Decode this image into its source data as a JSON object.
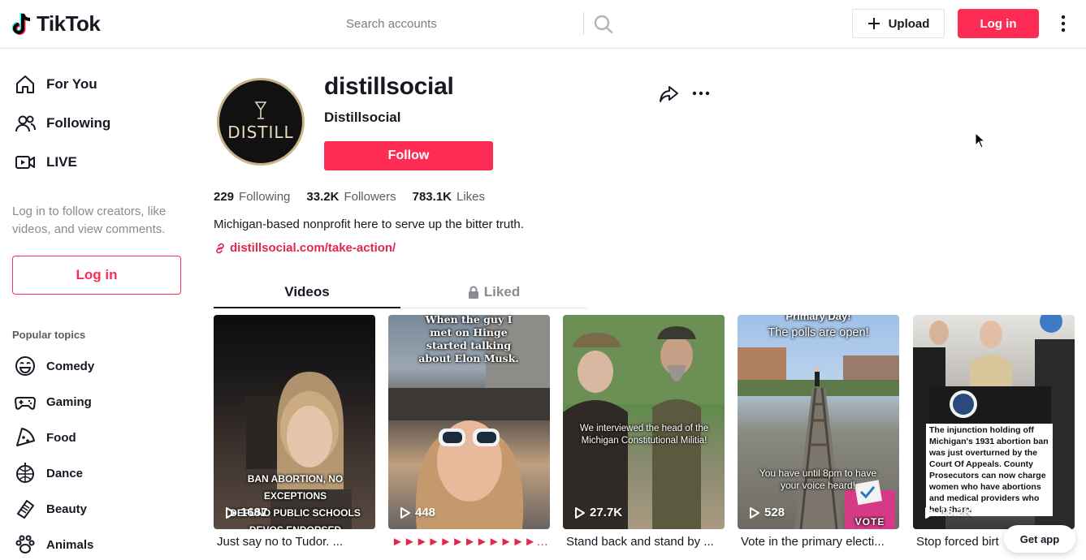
{
  "header": {
    "logo_text": "TikTok",
    "search_placeholder": "Search accounts",
    "upload_label": "Upload",
    "login_label": "Log in"
  },
  "sidebar": {
    "nav": [
      {
        "label": "For You",
        "icon": "home-icon"
      },
      {
        "label": "Following",
        "icon": "people-icon"
      },
      {
        "label": "LIVE",
        "icon": "live-icon"
      }
    ],
    "login_hint": "Log in to follow creators, like videos, and view comments.",
    "login_label": "Log in",
    "popular_title": "Popular topics",
    "topics": [
      {
        "label": "Comedy",
        "icon": "comedy-icon"
      },
      {
        "label": "Gaming",
        "icon": "gaming-icon"
      },
      {
        "label": "Food",
        "icon": "food-icon"
      },
      {
        "label": "Dance",
        "icon": "dance-icon"
      },
      {
        "label": "Beauty",
        "icon": "beauty-icon"
      },
      {
        "label": "Animals",
        "icon": "animals-icon"
      }
    ]
  },
  "profile": {
    "avatar_text": "DISTILL",
    "username": "distillsocial",
    "nickname": "Distillsocial",
    "follow_label": "Follow",
    "stats": [
      {
        "value": "229",
        "label": "Following"
      },
      {
        "value": "33.2K",
        "label": "Followers"
      },
      {
        "value": "783.1K",
        "label": "Likes"
      }
    ],
    "bio": "Michigan-based nonprofit here to serve up the bitter truth.",
    "link": "distillsocial.com/take-action/"
  },
  "tabs": {
    "videos": "Videos",
    "liked": "Liked"
  },
  "videos": [
    {
      "views": "1687",
      "caption": "Just say no to Tudor. ...",
      "overlay": "BAN ABORTION, NO EXCEPTIONS\nDEFUND PUBLIC SCHOOLS\nDEVOS ENDORSED"
    },
    {
      "views": "448",
      "caption": "►►►►►►►►►►►►►►...",
      "overlay": "When the guy I met on Hinge started talking about Elon Musk."
    },
    {
      "views": "27.7K",
      "caption": "Stand back and stand by ...",
      "overlay": "We interviewed the head of the Michigan Constitutional Militia!"
    },
    {
      "views": "528",
      "caption": "Vote in the primary electi...",
      "overlay_top": "Primary Day!",
      "overlay_main": "The polls are open!",
      "overlay_bottom": "You have until 8pm to have your voice heard!",
      "badge": "VOTE"
    },
    {
      "views": "18.2K",
      "caption": "Stop forced birt",
      "overlay": "The injunction holding off Michigan's 1931 abortion ban was just overturned by the Court Of Appeals. County Prosecutors can now charge women who have abortions and medical providers who help them."
    }
  ],
  "get_app_label": "Get app",
  "colors": {
    "accent": "#fe2c55",
    "link": "#e4264f",
    "text": "#161823",
    "muted": "#8a8b91"
  }
}
